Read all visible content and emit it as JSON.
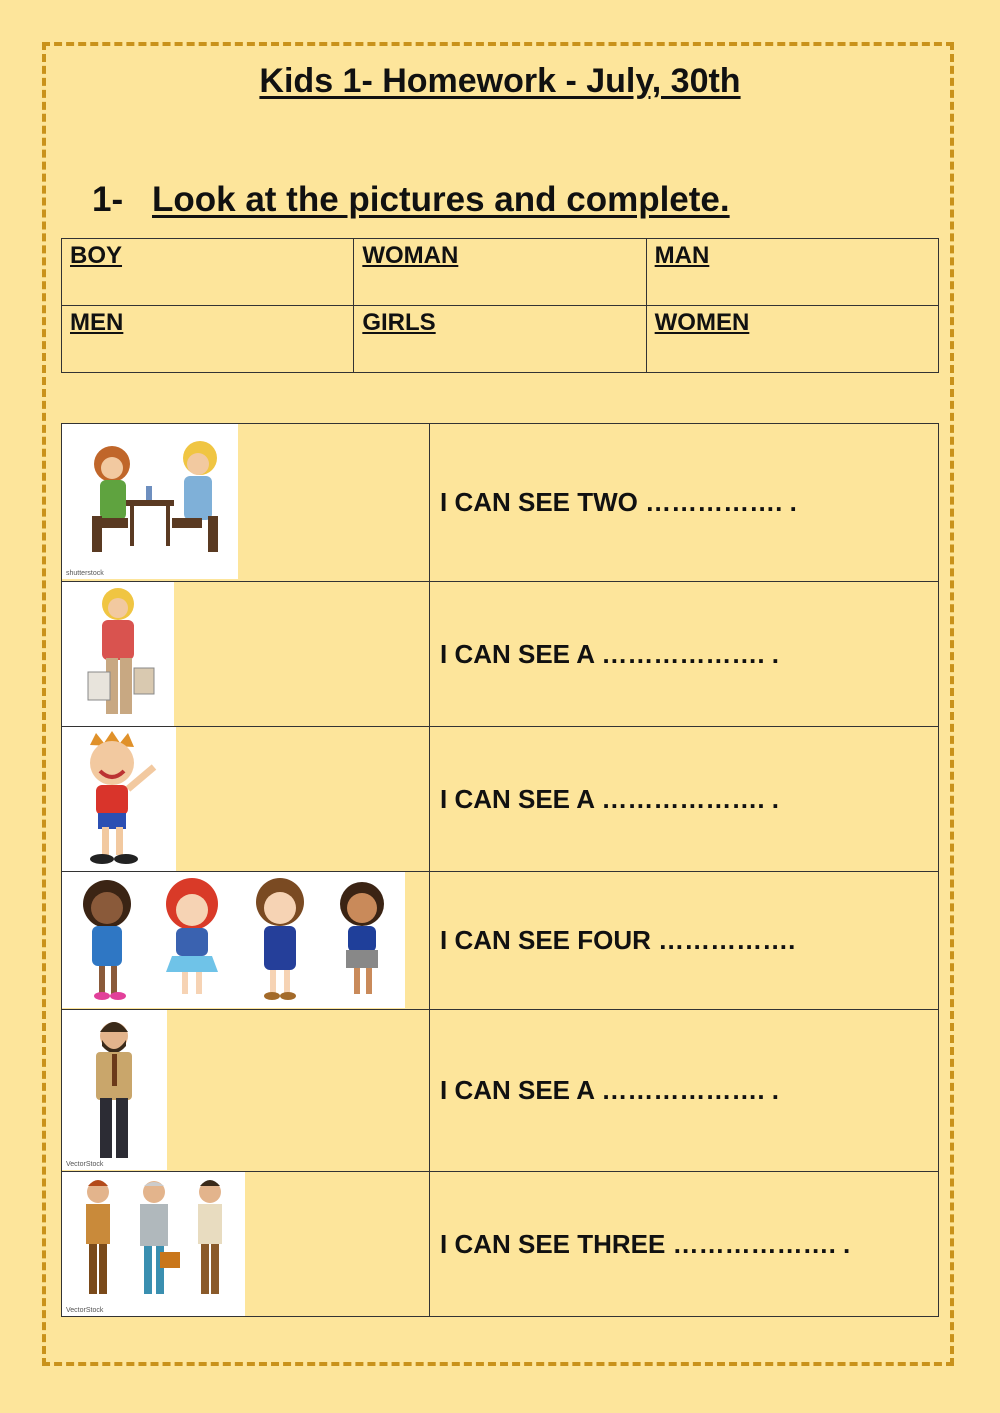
{
  "title": "Kids 1- Homework - July, 30th",
  "question": {
    "number": "1-",
    "instruction": "Look at the pictures and complete."
  },
  "word_bank": [
    [
      "BOY",
      "WOMAN",
      "MAN"
    ],
    [
      "MEN",
      "GIRLS",
      "WOMEN"
    ]
  ],
  "rows": [
    {
      "picture": "two-women-at-table-picture",
      "watermark": "shutterstock",
      "sentence": "I CAN SEE TWO ……………. ."
    },
    {
      "picture": "woman-with-bags-picture",
      "watermark": "",
      "sentence": "I CAN SEE A ………………. ."
    },
    {
      "picture": "boy-waving-picture",
      "watermark": "",
      "sentence": "I CAN SEE A ………………. ."
    },
    {
      "picture": "four-girls-picture",
      "watermark": "",
      "sentence": "I CAN SEE FOUR ……………."
    },
    {
      "picture": "man-in-tie-picture",
      "watermark": "VectorStock",
      "sentence": "I CAN SEE A ………………. ."
    },
    {
      "picture": "three-men-picture",
      "watermark": "VectorStock",
      "sentence": "I CAN SEE THREE ………………. ."
    }
  ]
}
